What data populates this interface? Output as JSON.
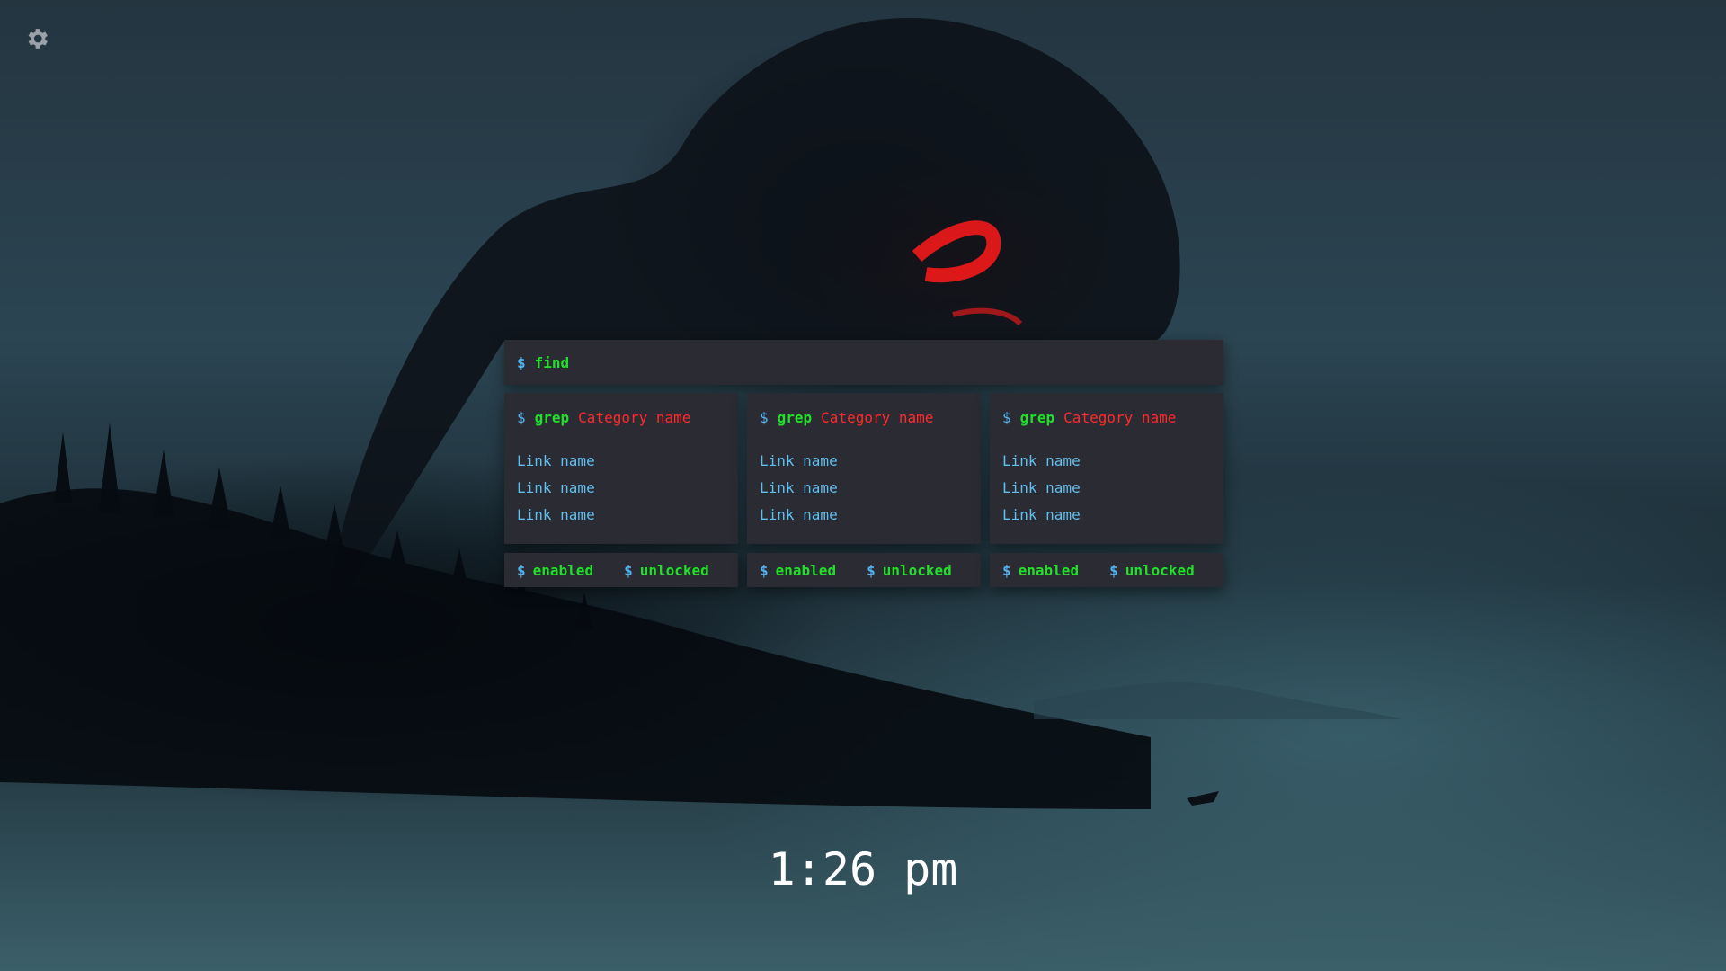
{
  "search": {
    "prompt": "$",
    "command": "find"
  },
  "categories": [
    {
      "prompt": "$",
      "command": "grep",
      "name": "Category name",
      "links": [
        "Link name",
        "Link name",
        "Link name"
      ]
    },
    {
      "prompt": "$",
      "command": "grep",
      "name": "Category name",
      "links": [
        "Link name",
        "Link name",
        "Link name"
      ]
    },
    {
      "prompt": "$",
      "command": "grep",
      "name": "Category name",
      "links": [
        "Link name",
        "Link name",
        "Link name"
      ]
    }
  ],
  "status": [
    {
      "prompt": "$",
      "a": "enabled",
      "b": "unlocked"
    },
    {
      "prompt": "$",
      "a": "enabled",
      "b": "unlocked"
    },
    {
      "prompt": "$",
      "a": "enabled",
      "b": "unlocked"
    }
  ],
  "clock": "1:26 pm",
  "icons": {
    "settings": "gear-icon"
  },
  "colors": {
    "prompt": "#4fb4f2",
    "command": "#22e02a",
    "category": "#ff2a2a",
    "link": "#5fc0f0",
    "panel": "#2a2b33"
  }
}
